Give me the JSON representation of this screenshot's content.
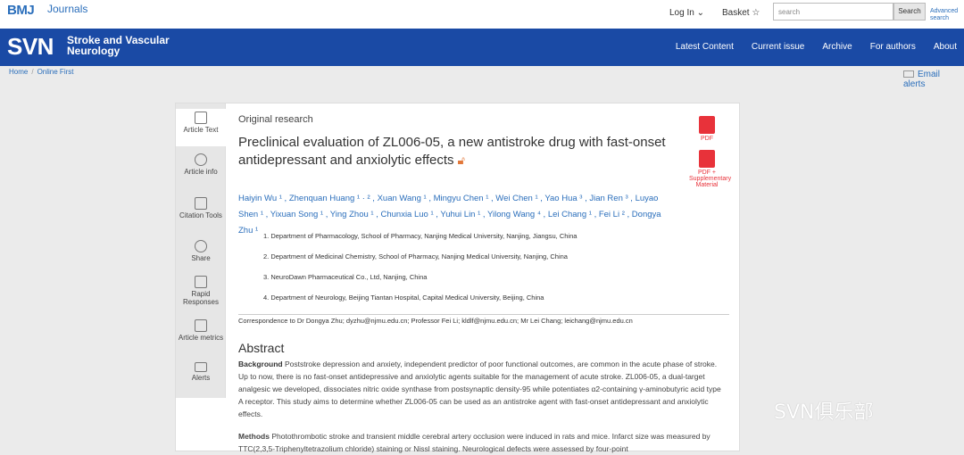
{
  "header": {
    "brand": "BMJ",
    "brand_sub": "Journals",
    "login": "Log In ⌄",
    "basket": "Basket ☆",
    "search_placeholder": "search",
    "search_button": "Search",
    "advanced": "Advanced search"
  },
  "navbar": {
    "logo": "SVN",
    "journal_name": "Stroke and Vascular Neurology",
    "links": [
      "Latest Content",
      "Current issue",
      "Archive",
      "For authors",
      "About"
    ]
  },
  "breadcrumb": [
    "Home",
    "Online First"
  ],
  "email_alerts": "Email alerts",
  "sidebar": [
    {
      "label": "Article Text",
      "icon": "document-icon",
      "active": true
    },
    {
      "label": "Article info",
      "icon": "info-icon"
    },
    {
      "label": "Citation Tools",
      "icon": "citation-icon"
    },
    {
      "label": "Share",
      "icon": "share-icon"
    },
    {
      "label": "Rapid Responses",
      "icon": "reply-icon"
    },
    {
      "label": "Article metrics",
      "icon": "metrics-icon"
    },
    {
      "label": "Alerts",
      "icon": "envelope-icon"
    }
  ],
  "article": {
    "type": "Original research",
    "title": "Preclinical evaluation of ZL006-05, a new antistroke drug with fast-onset antidepressant and anxiolytic effects",
    "pdf": "PDF",
    "pdf_supp": "PDF + Supplementary Material",
    "authors": "Haiyin Wu ¹ , Zhenquan Huang ¹ · ² , Xuan Wang ¹ , Mingyu Chen ¹ , Wei Chen ¹ , Yao Hua ³ , Jian Ren ³ , Luyao Shen ¹ , Yixuan Song ¹ , Ying Zhou ¹ , Chunxia Luo ¹ , Yuhui Lin ¹ , Yilong Wang ⁴ , Lei Chang ¹ , Fei Li ² , Dongya Zhu ¹",
    "affiliations": [
      "1. Department of Pharmacology, School of Pharmacy, Nanjing Medical University, Nanjing, Jiangsu, China",
      "2. Department of Medicinal Chemistry, School of Pharmacy, Nanjing Medical University, Nanjing, China",
      "3. NeuroDawn Pharmaceutical Co., Ltd, Nanjing, China",
      "4. Department of Neurology, Beijing Tiantan Hospital, Capital Medical University, Beijing, China"
    ],
    "correspondence": "Correspondence to Dr Dongya Zhu; dyzhu@njmu.edu.cn; Professor Fei Li; kldlf@njmu.edu.cn; Mr Lei Chang; leichang@njmu.edu.cn",
    "abstract_heading": "Abstract",
    "background_label": "Background",
    "background_text": "Poststroke depression and anxiety, independent predictor of poor functional outcomes, are common in the acute phase of stroke. Up to now, there is no fast-onset antidepressive and anxiolytic agents suitable for the management of acute stroke. ZL006-05, a dual-target analgesic we developed, dissociates nitric oxide synthase from postsynaptic density-95 while potentiates α2-containing γ-aminobutyric acid type A receptor. This study aims to determine whether ZL006-05 can be used as an antistroke agent with fast-onset antidepressant and anxiolytic effects.",
    "methods_label": "Methods",
    "methods_text": "Photothrombotic stroke and transient middle cerebral artery occlusion were induced in rats and mice. Infarct size was measured by TTC(2,3,5-Triphenyltetrazolium chloride) staining or Nissl staining. Neurological defects were assessed by four-point"
  },
  "watermark": "SVN俱乐部"
}
